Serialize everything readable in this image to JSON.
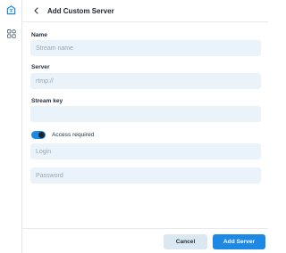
{
  "header": {
    "title": "Add Custom Server"
  },
  "form": {
    "name": {
      "label": "Name",
      "placeholder": "Stream name"
    },
    "server": {
      "label": "Server",
      "placeholder": "rtmp://"
    },
    "stream_key": {
      "label": "Stream key",
      "placeholder": ""
    },
    "access_required": {
      "label": "Access required",
      "enabled": true
    },
    "login": {
      "placeholder": "Login"
    },
    "password": {
      "placeholder": "Password"
    }
  },
  "footer": {
    "cancel_label": "Cancel",
    "add_label": "Add Server"
  },
  "colors": {
    "accent": "#1e88e5",
    "field_bg": "#eaf3f9",
    "cancel_bg": "#dbe7f1"
  },
  "icons": {
    "rail_top": "broadcast-icon",
    "rail_item": "widgets-icon",
    "back": "chevron-left-icon"
  }
}
